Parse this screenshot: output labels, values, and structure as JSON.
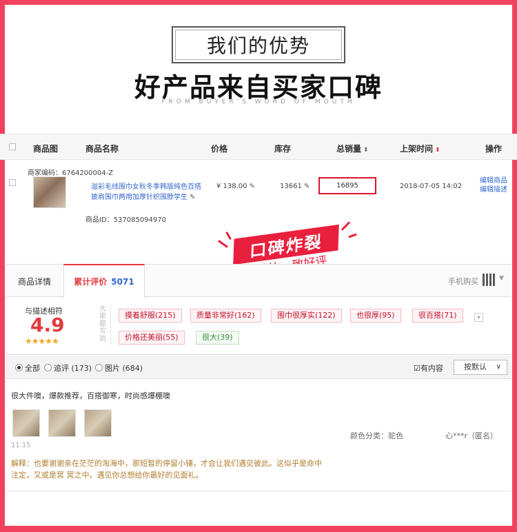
{
  "header": {
    "badge_title": "我们的优势",
    "headline": "好产品来自买家口碑",
    "subline": "FROM BUYER'S WORD OF MOUTH"
  },
  "table": {
    "columns": {
      "image": "商品图",
      "name": "商品名称",
      "price": "价格",
      "stock": "库存",
      "sales": "总销量",
      "listed": "上架时间",
      "action": "操作"
    },
    "row": {
      "merchant_code": "商家编码：6764200004-Z",
      "name_line1": "溢彩毛线围巾女秋冬季韩版纯色百搭",
      "name_line2": "披肩围巾两用加厚针织围脖学生",
      "price": "¥ 138.00",
      "stock": "13661",
      "sales": "16895",
      "listed": "2018-07-05 14:02",
      "action_edit": "编辑商品",
      "action_desc": "编辑描述",
      "product_id": "商品ID：537085094970"
    }
  },
  "stamp": {
    "main": "口碑炸裂",
    "sub": "性价比一致好评"
  },
  "tabs": {
    "detail": "商品详情",
    "reviews_label": "累计评价",
    "reviews_count": "5071",
    "mobile": "手机购买"
  },
  "rating": {
    "label": "与描述相符",
    "score": "4.9",
    "stars": "★★★★★",
    "vertical_label": "大家都写到",
    "impressions": [
      {
        "text": "摸着舒服(215)",
        "kind": "pos"
      },
      {
        "text": "质量非常好(162)",
        "kind": "pos"
      },
      {
        "text": "围巾很厚实(122)",
        "kind": "pos"
      },
      {
        "text": "也很厚(95)",
        "kind": "pos"
      },
      {
        "text": "很百搭(71)",
        "kind": "pos"
      },
      {
        "text": "价格还美丽(55)",
        "kind": "pos"
      },
      {
        "text": "很大(39)",
        "kind": "neu"
      }
    ]
  },
  "filter": {
    "all": "全部",
    "followup": "追评 (173)",
    "images": "图片 (684)",
    "has_content": "有内容",
    "sort": "按默认"
  },
  "review": {
    "text": "很大件噢，爆款推荐，百搭御寒，时尚感爆棚噢",
    "date": "11.15",
    "color": "颜色分类：驼色",
    "user": "心***r（匿名）",
    "reply_line1": "解释：也要谢谢亲在茫茫的淘海中，那短暂的停留小铺，才会让我们遇见彼此。这似乎是命中",
    "reply_line2": "注定，又或是冥 冥之中。遇见你总想给你最好的见面礼。"
  },
  "colors": {
    "frame": "#f0425f",
    "accent_red": "#e4393c",
    "link_blue": "#3366cc"
  }
}
